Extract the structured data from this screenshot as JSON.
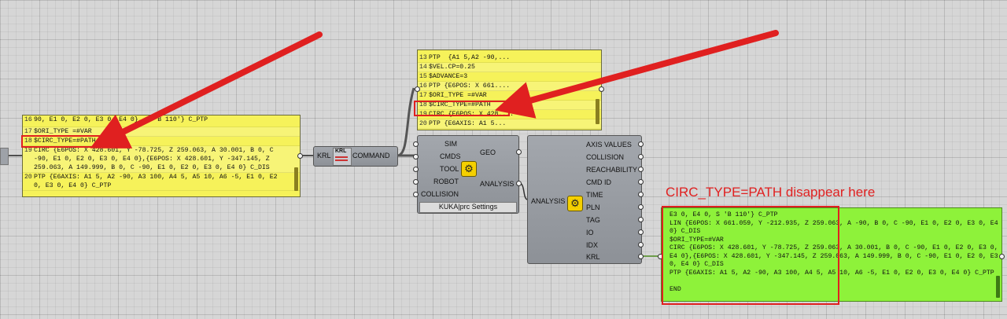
{
  "left_panel": {
    "lines": [
      {
        "n": "16",
        "t": "90, E1 0, E2 0, E3 0, E4 0}, S 'B 110'} C_PTP"
      },
      {
        "n": "17",
        "t": "$ORI_TYPE =#VAR"
      },
      {
        "n": "18",
        "t": "$CIRC_TYPE=#PATH"
      },
      {
        "n": "19",
        "t": "CIRC {E6POS: X 428.601, Y -78.725, Z 259.063, A 30.001, B 0, C -90, E1 0, E2 0, E3 0, E4 0},{E6POS: X 428.601, Y -347.145, Z 259.063, A 149.999, B 0, C -90, E1 0, E2 0, E3 0, E4 0} C_DIS"
      },
      {
        "n": "20",
        "t": "PTP {E6AXIS: A1 5, A2 -90, A3 100, A4 5, A5 10, A6 -5, E1 0, E2 0, E3 0, E4 0} C_PTP"
      }
    ]
  },
  "top_panel": {
    "lines": [
      {
        "n": "13",
        "t": "PTP  {A1 5,A2 -90,..."
      },
      {
        "n": "14",
        "t": "$VEL.CP=0.25"
      },
      {
        "n": "15",
        "t": "$ADVANCE=3"
      },
      {
        "n": "16",
        "t": "PTP {E6POS: X 661...."
      },
      {
        "n": "17",
        "t": "$ORI_TYPE =#VAR"
      },
      {
        "n": "18",
        "t": "$CIRC_TYPE=#PATH"
      },
      {
        "n": "19",
        "t": "CIRC {E6POS: X 428...."
      },
      {
        "n": "20",
        "t": "PTP {E6AXIS: A1 5..."
      }
    ]
  },
  "krl_component": {
    "input": "KRL",
    "icon_label": "KRL",
    "output": "COMMAND"
  },
  "kuka_component": {
    "inputs": [
      "SIM",
      "CMDS",
      "TOOL",
      "ROBOT",
      "COLLISION"
    ],
    "outputs": [
      "GEO",
      "ANALYSIS"
    ],
    "footer": "KUKA|prc Settings"
  },
  "analysis_component": {
    "input": "ANALYSIS",
    "outputs": [
      "AXIS VALUES",
      "COLLISION",
      "REACHABILITY",
      "CMD ID",
      "TIME",
      "PLN",
      "TAG",
      "IO",
      "IDX",
      "KRL"
    ]
  },
  "green_panel": {
    "text": "E3 0, E4 0, S 'B 110'} C_PTP\nLIN {E6POS: X 661.059, Y -212.935, Z 259.063, A -90, B 0, C -90, E1 0, E2 0, E3 0, E4 0} C_DIS\n$ORI_TYPE=#VAR\nCIRC {E6POS: X 428.601, Y -78.725, Z 259.063, A 30.001, B 0, C -90, E1 0, E2 0, E3 0, E4 0},{E6POS: X 428.601, Y -347.145, Z 259.063, A 149.999, B 0, C -90, E1 0, E2 0, E3 0, E4 0} C_DIS\nPTP {E6AXIS: A1 5, A2 -90, A3 100, A4 5, A5 10, A6 -5, E1 0, E2 0, E3 0, E4 0} C_PTP\n\nEND"
  },
  "annotation": {
    "text": "CIRC_TYPE=PATH disappear here"
  },
  "colors": {
    "arrow": "#e02020",
    "yellow_panel": "#f6f25a",
    "green_panel": "#8ef23a"
  }
}
